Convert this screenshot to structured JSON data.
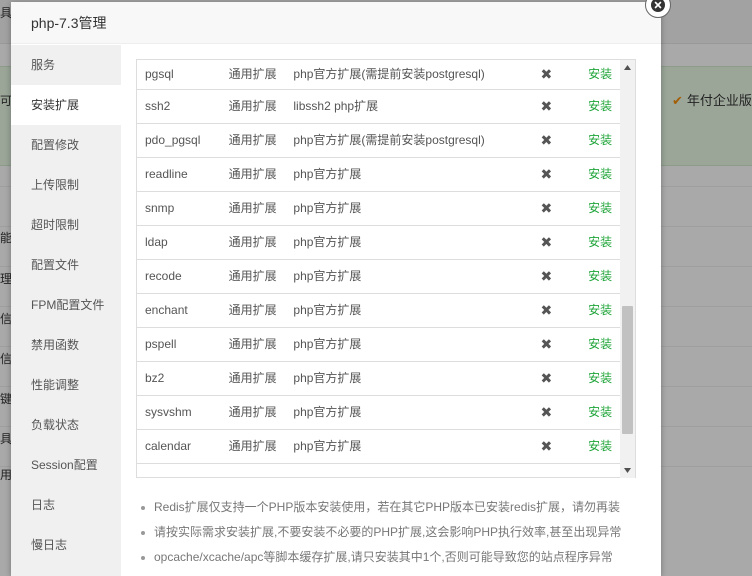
{
  "background": {
    "left_fragments": [
      "具",
      "可",
      "能力",
      "理",
      "信",
      "信",
      "键",
      "具",
      "用于"
    ],
    "right_text": "年付企业版"
  },
  "dialog": {
    "title": "php-7.3管理",
    "close_icon": "close-icon"
  },
  "sidebar": {
    "items": [
      {
        "label": "服务"
      },
      {
        "label": "安装扩展",
        "active": true
      },
      {
        "label": "配置修改"
      },
      {
        "label": "上传限制"
      },
      {
        "label": "超时限制"
      },
      {
        "label": "配置文件"
      },
      {
        "label": "FPM配置文件"
      },
      {
        "label": "禁用函数"
      },
      {
        "label": "性能调整"
      },
      {
        "label": "负载状态"
      },
      {
        "label": "Session配置"
      },
      {
        "label": "日志"
      },
      {
        "label": "慢日志"
      }
    ]
  },
  "extensions": {
    "status_icon": "cross-icon",
    "rows": [
      {
        "name": "pgsql",
        "type": "通用扩展",
        "desc": "php官方扩展(需提前安装postgresql)",
        "status": "✖",
        "action": "安装"
      },
      {
        "name": "ssh2",
        "type": "通用扩展",
        "desc": "libssh2 php扩展",
        "status": "✖",
        "action": "安装"
      },
      {
        "name": "pdo_pgsql",
        "type": "通用扩展",
        "desc": "php官方扩展(需提前安装postgresql)",
        "status": "✖",
        "action": "安装"
      },
      {
        "name": "readline",
        "type": "通用扩展",
        "desc": "php官方扩展",
        "status": "✖",
        "action": "安装"
      },
      {
        "name": "snmp",
        "type": "通用扩展",
        "desc": "php官方扩展",
        "status": "✖",
        "action": "安装"
      },
      {
        "name": "ldap",
        "type": "通用扩展",
        "desc": "php官方扩展",
        "status": "✖",
        "action": "安装"
      },
      {
        "name": "recode",
        "type": "通用扩展",
        "desc": "php官方扩展",
        "status": "✖",
        "action": "安装"
      },
      {
        "name": "enchant",
        "type": "通用扩展",
        "desc": "php官方扩展",
        "status": "✖",
        "action": "安装"
      },
      {
        "name": "pspell",
        "type": "通用扩展",
        "desc": "php官方扩展",
        "status": "✖",
        "action": "安装"
      },
      {
        "name": "bz2",
        "type": "通用扩展",
        "desc": "php官方扩展",
        "status": "✖",
        "action": "安装"
      },
      {
        "name": "sysvshm",
        "type": "通用扩展",
        "desc": "php官方扩展",
        "status": "✖",
        "action": "安装"
      },
      {
        "name": "calendar",
        "type": "通用扩展",
        "desc": "php官方扩展",
        "status": "✖",
        "action": "安装"
      }
    ]
  },
  "notes": [
    "Redis扩展仅支持一个PHP版本安装使用，若在其它PHP版本已安装redis扩展，请勿再装",
    "请按实际需求安装扩展,不要安装不必要的PHP扩展,这会影响PHP执行效率,甚至出现异常",
    "opcache/xcache/apc等脚本缓存扩展,请只安装其中1个,否则可能导致您的站点程序异常"
  ],
  "colors": {
    "install_link": "#20a53a",
    "overlay": "rgba(0,0,0,0.3)",
    "sidebar_bg": "#f0f0f0"
  }
}
